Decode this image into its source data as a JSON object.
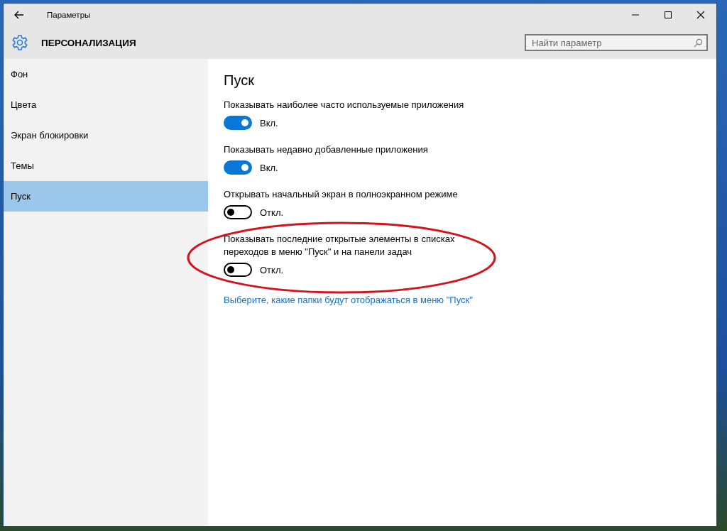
{
  "window": {
    "title": "Параметры"
  },
  "header": {
    "title": "ПЕРСОНАЛИЗАЦИЯ"
  },
  "search": {
    "placeholder": "Найти параметр"
  },
  "sidebar": {
    "items": [
      {
        "label": "Фон",
        "selected": false
      },
      {
        "label": "Цвета",
        "selected": false
      },
      {
        "label": "Экран блокировки",
        "selected": false
      },
      {
        "label": "Темы",
        "selected": false
      },
      {
        "label": "Пуск",
        "selected": true
      }
    ]
  },
  "page": {
    "heading": "Пуск",
    "settings": [
      {
        "label": "Показывать наиболее часто используемые приложения",
        "on": true,
        "state_text": "Вкл."
      },
      {
        "label": "Показывать недавно добавленные приложения",
        "on": true,
        "state_text": "Вкл."
      },
      {
        "label": "Открывать начальный экран в полноэкранном режиме",
        "on": false,
        "state_text": "Откл."
      },
      {
        "label": "Показывать последние открытые элементы в списках переходов в меню \"Пуск\" и на панели задач",
        "on": false,
        "state_text": "Откл."
      }
    ],
    "link": "Выберите, какие папки будут отображаться в меню \"Пуск\""
  }
}
